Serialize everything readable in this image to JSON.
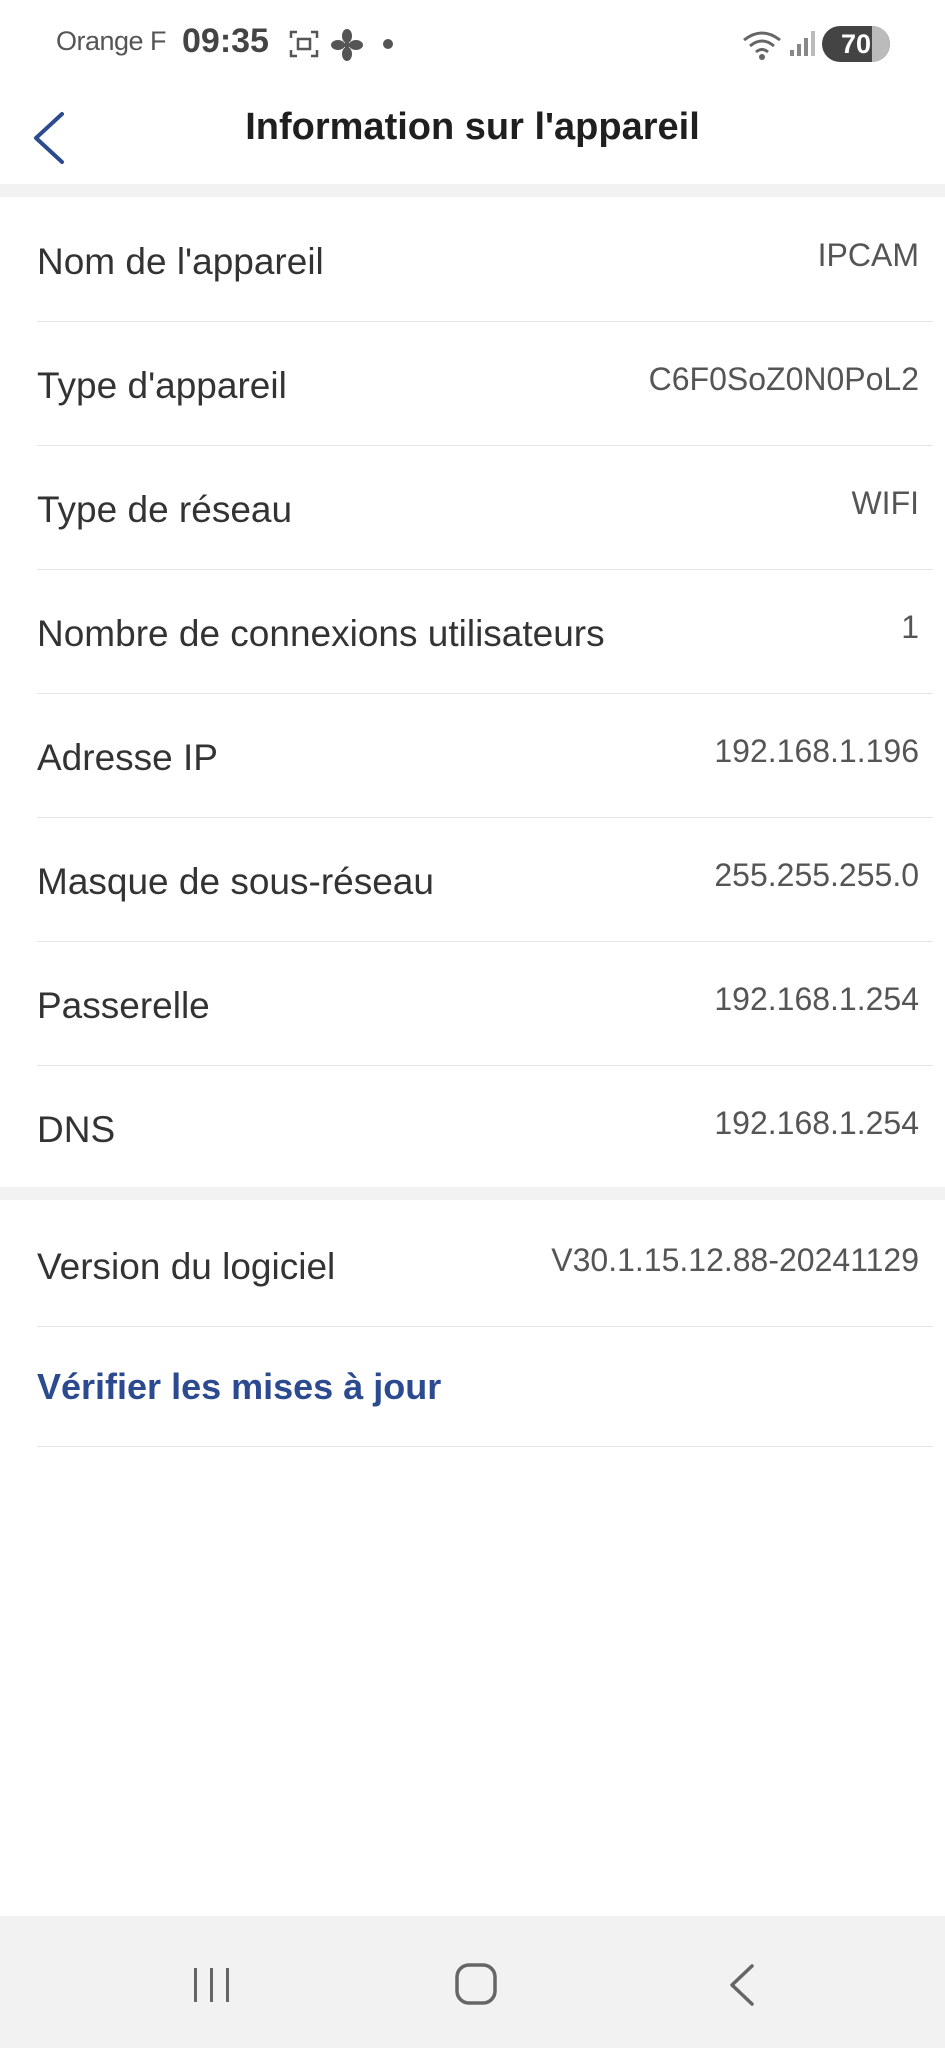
{
  "status_bar": {
    "carrier": "Orange F",
    "time": "09:35",
    "battery": "70",
    "icons": [
      "screenshot-icon",
      "fan-icon",
      "notification-dot",
      "wifi-icon",
      "signal-icon",
      "battery-icon"
    ]
  },
  "header": {
    "title": "Information sur l'appareil",
    "back_icon": "chevron-left-icon"
  },
  "info_rows": [
    {
      "label": "Nom de l'appareil",
      "value": "IPCAM"
    },
    {
      "label": "Type d'appareil",
      "value": "C6F0SoZ0N0PoL2"
    },
    {
      "label": "Type de réseau",
      "value": "WIFI"
    },
    {
      "label": "Nombre de connexions utilisateurs",
      "value": "1"
    },
    {
      "label": "Adresse IP",
      "value": "192.168.1.196"
    },
    {
      "label": "Masque de sous-réseau",
      "value": "255.255.255.0"
    },
    {
      "label": "Passerelle",
      "value": "192.168.1.254"
    },
    {
      "label": "DNS",
      "value": "192.168.1.254"
    }
  ],
  "software": {
    "label": "Version du logiciel",
    "value": "V30.1.15.12.88-20241129",
    "update_link": "Vérifier les mises à jour"
  },
  "colors": {
    "link": "#2b4a8f",
    "back_chevron": "#2b4a8f",
    "separator": "#f2f2f2"
  },
  "nav_bar": {
    "icons": [
      "recents-icon",
      "home-icon",
      "back-icon"
    ]
  }
}
